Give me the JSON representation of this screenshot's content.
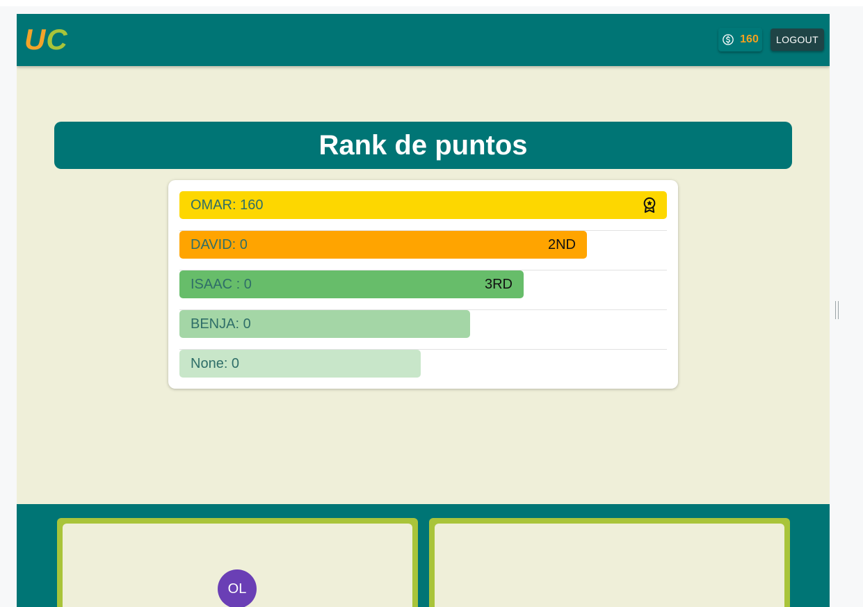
{
  "header": {
    "logo_u": "U",
    "logo_c": "C",
    "coins": "160",
    "logout_label": "LOGOUT"
  },
  "main": {
    "title": "Rank de puntos",
    "ranking": [
      {
        "label": "OMAR: 160",
        "place": "",
        "badge": "medal-icon",
        "color": "#fdd700",
        "relative_length": 1.0
      },
      {
        "label": "DAVID: 0",
        "place": "2ND",
        "color": "#ffa400",
        "relative_length": 0.836
      },
      {
        "label": "ISAAC : 0",
        "place": "3RD",
        "color": "#67bd6a",
        "relative_length": 0.706
      },
      {
        "label": "BENJA: 0",
        "place": "",
        "color": "#a4d6a6",
        "relative_length": 0.596
      },
      {
        "label": "None: 0",
        "place": "",
        "color": "#c8e6c9",
        "relative_length": 0.495
      }
    ]
  },
  "footer": {
    "avatar_initials": "OL"
  },
  "colors": {
    "primary": "#007575",
    "background": "#efefd9",
    "accent_green": "#a8c43a",
    "accent_orange": "#f3a42a",
    "avatar": "#6a3fb5"
  }
}
